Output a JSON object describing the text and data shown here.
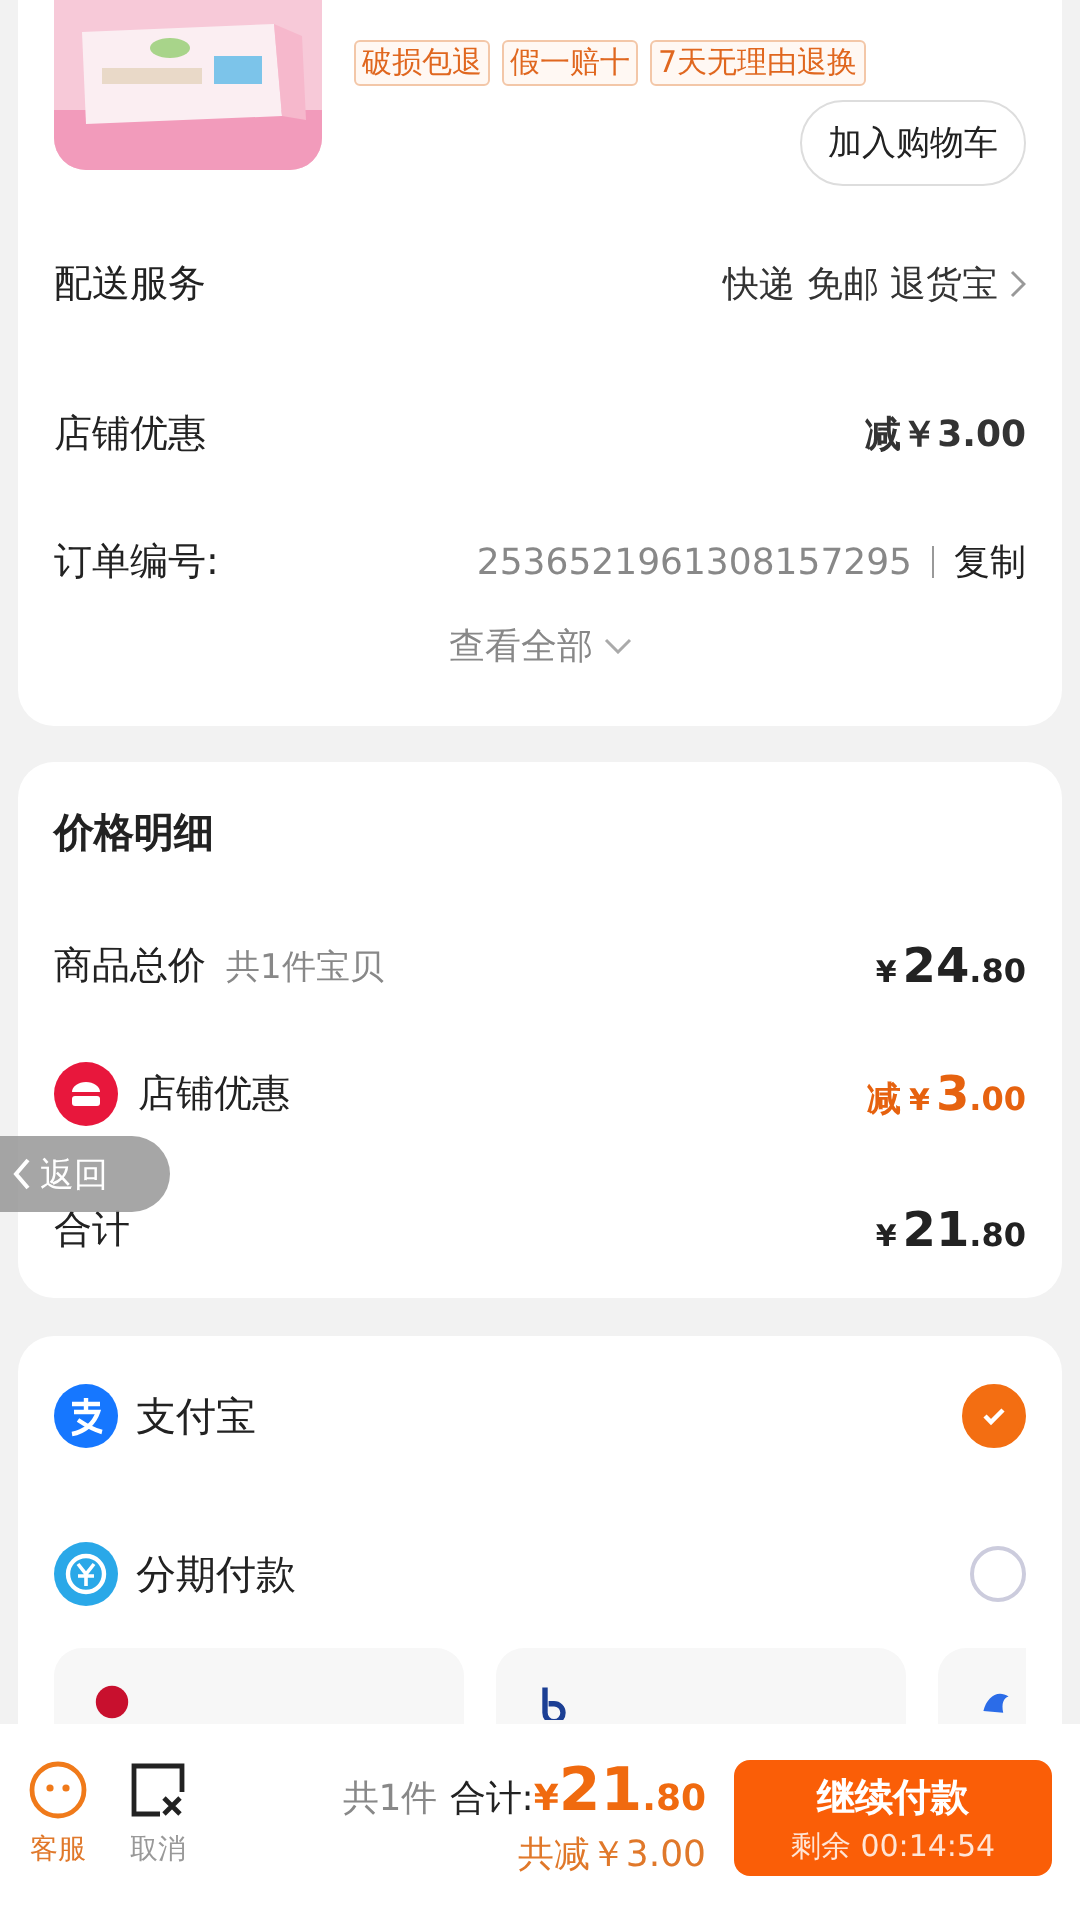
{
  "product": {
    "tags": [
      "破损包退",
      "假一赔十",
      "7天无理由退换"
    ],
    "add_to_cart": "加入购物车"
  },
  "order_info": [
    {
      "kind": "link",
      "label": "配送服务",
      "value": "快递 免邮 退货宝"
    },
    {
      "kind": "amount",
      "label": "店铺优惠",
      "value": "减￥3.00"
    },
    {
      "kind": "copy",
      "label": "订单编号:",
      "value": "2536521961308157295",
      "action": "复制"
    }
  ],
  "view_all": "查看全部",
  "price_detail": {
    "title": "价格明细",
    "rows": [
      {
        "kind": "total",
        "label": "商品总价",
        "note": "共1件宝贝",
        "prefix": "",
        "currency": "¥",
        "integer": "24",
        "decimal": ".80"
      },
      {
        "kind": "discount",
        "label": "店铺优惠",
        "note": "",
        "prefix": "减",
        "currency": "¥",
        "integer": "3",
        "decimal": ".00"
      },
      {
        "kind": "sum",
        "label": "合计",
        "note": "",
        "prefix": "",
        "currency": "¥",
        "integer": "21",
        "decimal": ".80"
      }
    ]
  },
  "payment_methods": [
    {
      "kind": "alipay",
      "label": "支付宝",
      "selected": true
    },
    {
      "kind": "installment",
      "label": "分期付款",
      "selected": false
    }
  ],
  "bank_cards": [
    {
      "kind": "cmb"
    },
    {
      "kind": "bocom"
    },
    {
      "kind": "huabei"
    }
  ],
  "back_button": "返回",
  "footer": {
    "service": "客服",
    "cancel": "取消",
    "count": "共1件",
    "total_label": "合计:",
    "currency": "¥",
    "integer": "21",
    "decimal": ".80",
    "saved": "共减￥3.00",
    "pay": "继续付款",
    "remaining": "剩余 00:14:54"
  }
}
